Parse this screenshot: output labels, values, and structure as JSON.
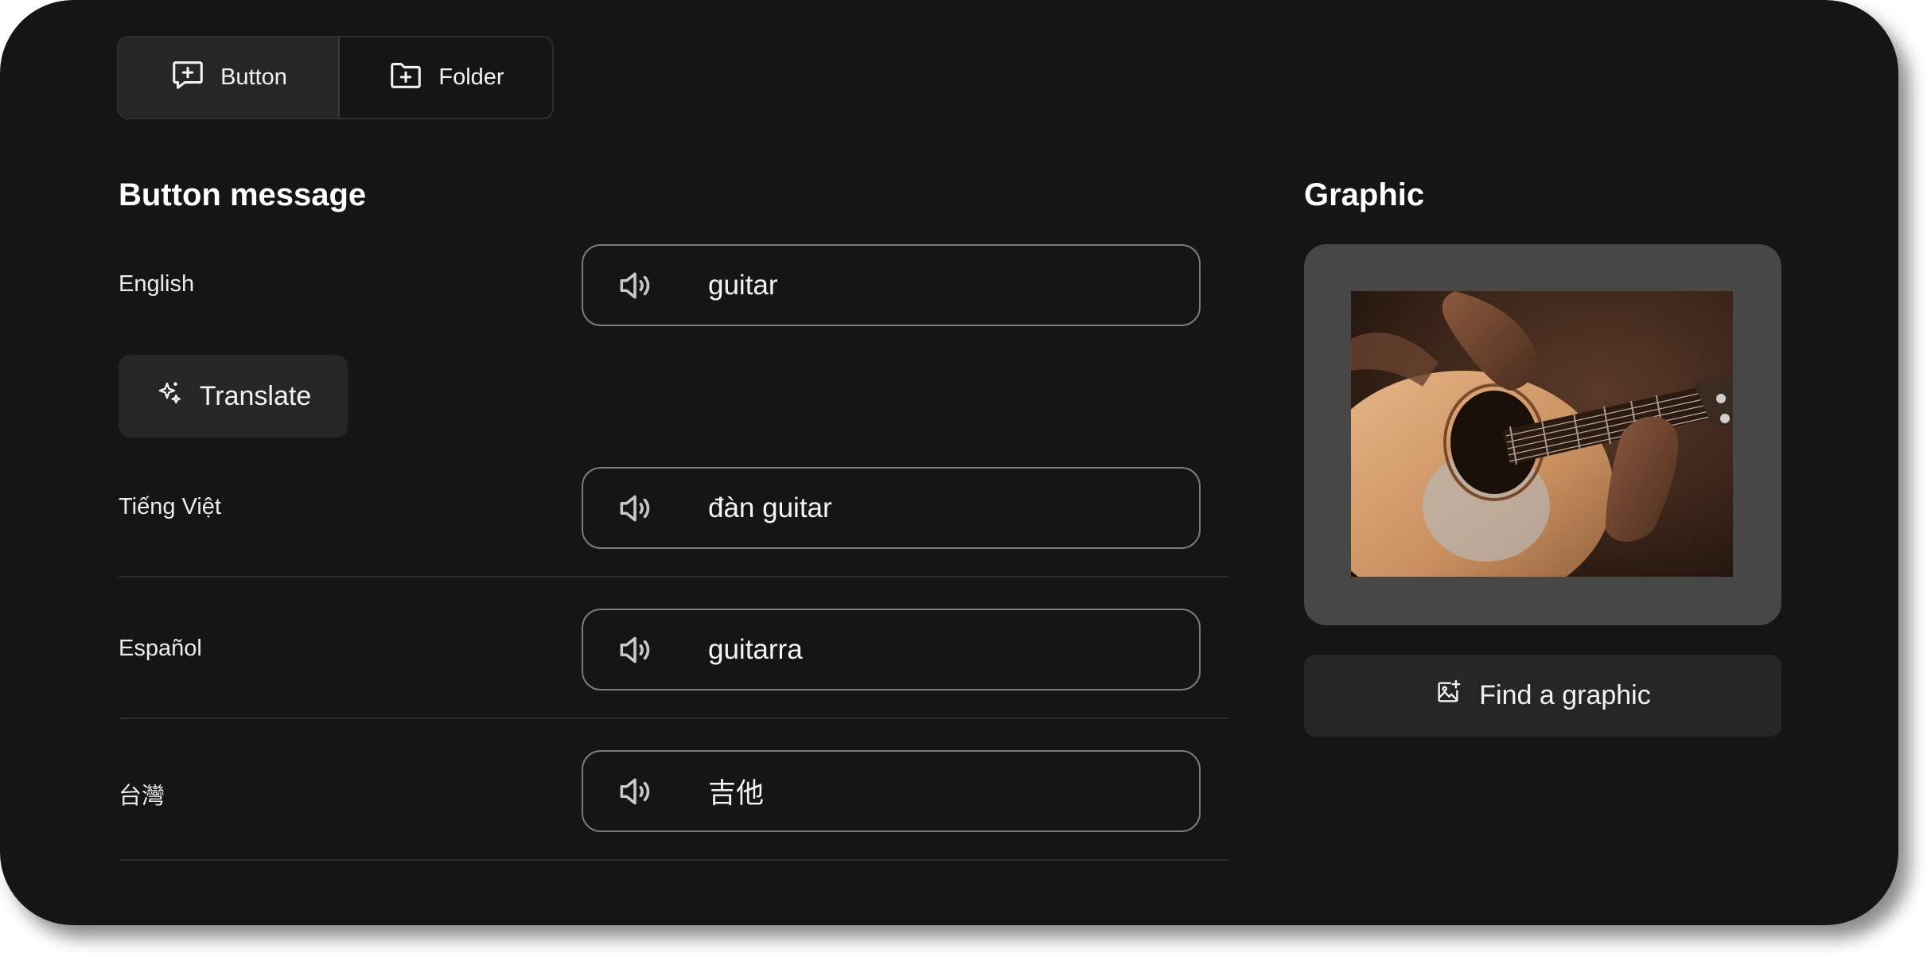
{
  "tabs": [
    {
      "label": "Button",
      "icon": "message-plus-icon",
      "selected": true
    },
    {
      "label": "Folder",
      "icon": "folder-plus-icon",
      "selected": false
    }
  ],
  "button_message": {
    "heading": "Button message",
    "translate_label": "Translate",
    "rows": [
      {
        "language": "English",
        "word": "guitar"
      },
      {
        "language": "Tiếng Việt",
        "word": "đàn guitar"
      },
      {
        "language": "Español",
        "word": "guitarra"
      },
      {
        "language": "台灣",
        "word": "吉他"
      }
    ]
  },
  "graphic": {
    "heading": "Graphic",
    "image_alt": "guitar-photo",
    "find_label": "Find a graphic"
  },
  "colors": {
    "background": "#151515",
    "surface": "#262626",
    "field_border": "#7b7b7b",
    "graphic_frame": "#474747"
  }
}
